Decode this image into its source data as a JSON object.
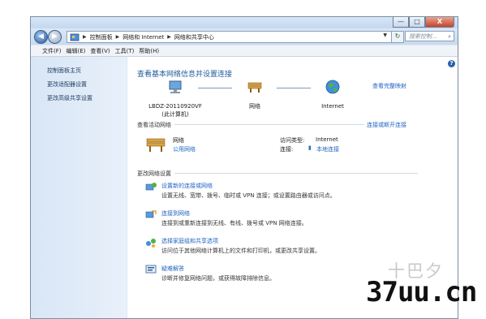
{
  "window": {
    "min_label": "—",
    "max_label": "□",
    "close_label": "X"
  },
  "address": {
    "crumbs": [
      "控制面板",
      "网络和 Internet",
      "网络和共享中心"
    ],
    "search_placeholder": "搜索控制..."
  },
  "menu": [
    "文件(F)",
    "编辑(E)",
    "查看(V)",
    "工具(T)",
    "帮助(H)"
  ],
  "sidebar": {
    "items": [
      {
        "label": "控制面板主页"
      },
      {
        "label": "更改适配器设置"
      },
      {
        "label": "更改高级共享设置"
      }
    ]
  },
  "main": {
    "title": "查看基本网络信息并设置连接",
    "full_map": "查看完整映射",
    "nodes": {
      "computer_name": "LBDZ-20110920VF",
      "computer_sub": "(此计算机)",
      "network": "网络",
      "internet": "Internet"
    },
    "active_label": "查看活动网络",
    "connect_label": "连接或断开连接",
    "active": {
      "name": "网络",
      "type": "公用网络",
      "access_label": "访问类型:",
      "access_value": "Internet",
      "conn_label": "连接:",
      "conn_value": "本地连接"
    },
    "change_label": "更改网络设置",
    "tasks": [
      {
        "title": "设置新的连接或网络",
        "desc": "设置无线、宽带、拨号、临时或 VPN 连接；或设置路由器或访问点。"
      },
      {
        "title": "连接到网络",
        "desc": "连接到或重新连接到无线、有线、拨号或 VPN 网络连接。"
      },
      {
        "title": "选择家庭组和共享选项",
        "desc": "访问位于其他网络计算机上的文件和打印机，或更改共享设置。"
      },
      {
        "title": "疑难解答",
        "desc": "诊断并修复网络问题，或获得故障排除信息。"
      }
    ]
  },
  "watermark": {
    "top": "十巴夕",
    "bottom": "37uu.cn"
  }
}
